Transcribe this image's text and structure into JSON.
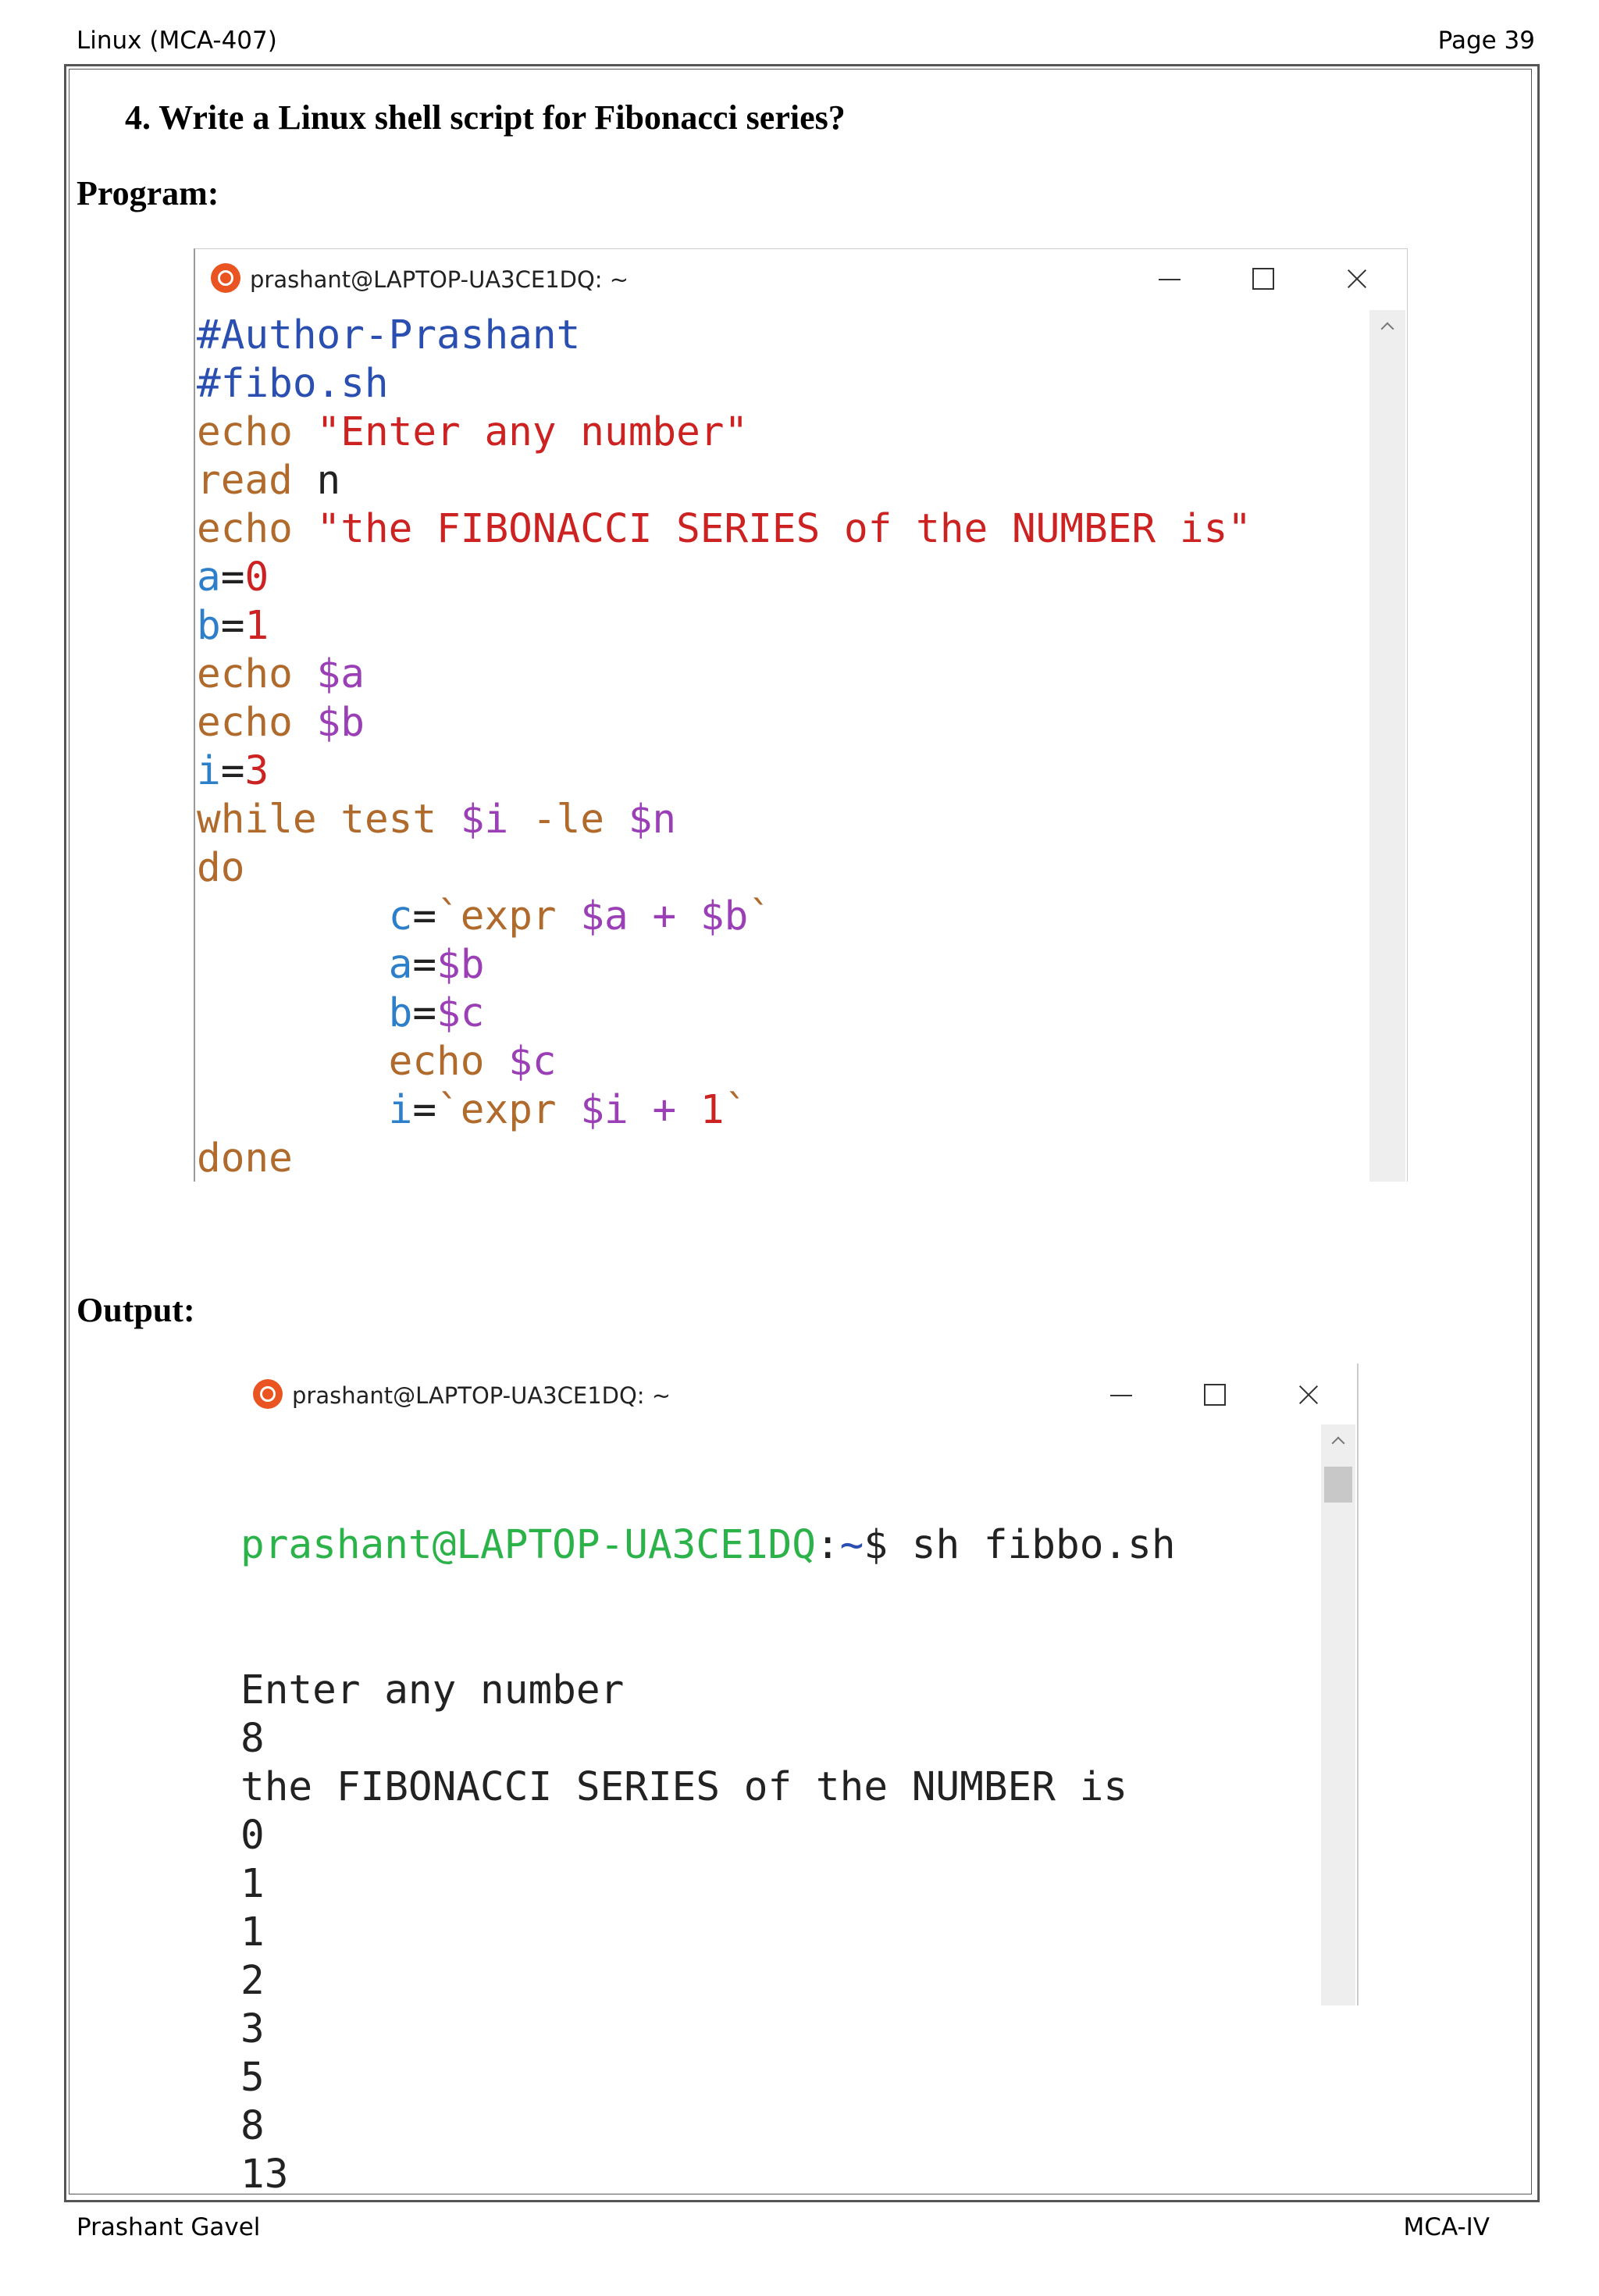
{
  "header": {
    "left": "Linux (MCA-407)",
    "right": "Page 39"
  },
  "question": "4.  Write a Linux shell script for Fibonacci series?",
  "program_heading": "Program:",
  "output_heading": "Output:",
  "program_window": {
    "title": "prashant@LAPTOP-UA3CE1DQ: ~",
    "lines": [
      [
        {
          "t": "#Author-Prashant",
          "c": "cmt"
        }
      ],
      [
        {
          "t": "#fibo.sh",
          "c": "cmt"
        }
      ],
      [
        {
          "t": "echo ",
          "c": "kw"
        },
        {
          "t": "\"Enter any number\"",
          "c": "str"
        }
      ],
      [
        {
          "t": "read ",
          "c": "kw"
        },
        {
          "t": "n",
          "c": "plain"
        }
      ],
      [
        {
          "t": "echo ",
          "c": "kw"
        },
        {
          "t": "\"the FIBONACCI SERIES of the NUMBER is\"",
          "c": "str"
        }
      ],
      [
        {
          "t": "a",
          "c": "var"
        },
        {
          "t": "=",
          "c": "plain"
        },
        {
          "t": "0",
          "c": "num"
        }
      ],
      [
        {
          "t": "b",
          "c": "var"
        },
        {
          "t": "=",
          "c": "plain"
        },
        {
          "t": "1",
          "c": "num"
        }
      ],
      [
        {
          "t": "echo ",
          "c": "kw"
        },
        {
          "t": "$a",
          "c": "dol"
        }
      ],
      [
        {
          "t": "echo ",
          "c": "kw"
        },
        {
          "t": "$b",
          "c": "dol"
        }
      ],
      [
        {
          "t": "i",
          "c": "var"
        },
        {
          "t": "=",
          "c": "plain"
        },
        {
          "t": "3",
          "c": "num"
        }
      ],
      [
        {
          "t": "while ",
          "c": "kw"
        },
        {
          "t": "test ",
          "c": "kw"
        },
        {
          "t": "$i",
          "c": "dol"
        },
        {
          "t": " -le ",
          "c": "kw"
        },
        {
          "t": "$n",
          "c": "dol"
        }
      ],
      [
        {
          "t": "do",
          "c": "kw"
        }
      ],
      [
        {
          "t": "        ",
          "c": "plain"
        },
        {
          "t": "c",
          "c": "var"
        },
        {
          "t": "=",
          "c": "plain"
        },
        {
          "t": "`",
          "c": "kw"
        },
        {
          "t": "expr ",
          "c": "kw"
        },
        {
          "t": "$a",
          "c": "dol"
        },
        {
          "t": " + ",
          "c": "expr"
        },
        {
          "t": "$b",
          "c": "dol"
        },
        {
          "t": "`",
          "c": "kw"
        }
      ],
      [
        {
          "t": "        ",
          "c": "plain"
        },
        {
          "t": "a",
          "c": "var"
        },
        {
          "t": "=",
          "c": "plain"
        },
        {
          "t": "$b",
          "c": "dol"
        }
      ],
      [
        {
          "t": "        ",
          "c": "plain"
        },
        {
          "t": "b",
          "c": "var"
        },
        {
          "t": "=",
          "c": "plain"
        },
        {
          "t": "$c",
          "c": "dol"
        }
      ],
      [
        {
          "t": "        ",
          "c": "plain"
        },
        {
          "t": "echo ",
          "c": "kw"
        },
        {
          "t": "$c",
          "c": "dol"
        }
      ],
      [
        {
          "t": "        ",
          "c": "plain"
        },
        {
          "t": "i",
          "c": "var"
        },
        {
          "t": "=",
          "c": "plain"
        },
        {
          "t": "`",
          "c": "kw"
        },
        {
          "t": "expr ",
          "c": "kw"
        },
        {
          "t": "$i",
          "c": "dol"
        },
        {
          "t": " + ",
          "c": "expr"
        },
        {
          "t": "1",
          "c": "num"
        },
        {
          "t": "`",
          "c": "kw"
        }
      ],
      [
        {
          "t": "done",
          "c": "kw"
        }
      ]
    ]
  },
  "output_window": {
    "title": "prashant@LAPTOP-UA3CE1DQ: ~",
    "prompt_user": "prashant@LAPTOP-UA3CE1DQ",
    "prompt_sep": ":",
    "prompt_path": "~",
    "prompt_dollar": "$ ",
    "command": "sh fibbo.sh",
    "lines": [
      "Enter any number",
      "8",
      "the FIBONACCI SERIES of the NUMBER is",
      "0",
      "1",
      "1",
      "2",
      "3",
      "5",
      "8",
      "13"
    ]
  },
  "footer": {
    "left": "Prashant Gavel",
    "right": "MCA-IV"
  },
  "colors": {
    "keyword": "#b06a2c",
    "string": "#cc2222",
    "variable": "#2e7fc9",
    "dollar_var": "#9a3fb5",
    "prompt_user": "#2bb34a",
    "prompt_path": "#2a4fb0",
    "ubuntu_icon": "#e95420"
  }
}
